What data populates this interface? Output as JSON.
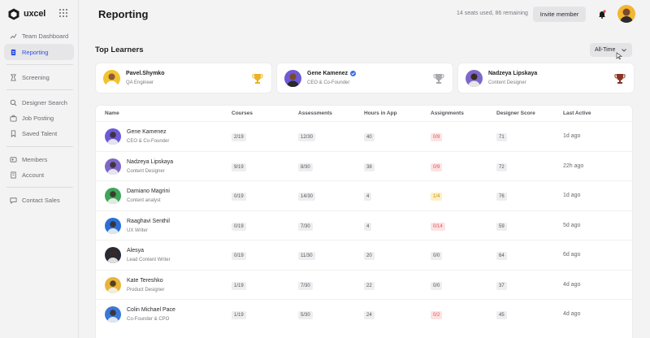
{
  "brand": {
    "name": "uxcel"
  },
  "sidebar": {
    "items": [
      {
        "label": "Team Dashboard",
        "icon": "trend-up-icon"
      },
      {
        "label": "Reporting",
        "icon": "report-icon",
        "active": true
      },
      {
        "label": "Screening",
        "icon": "screening-icon"
      },
      {
        "label": "Designer Search",
        "icon": "search-icon"
      },
      {
        "label": "Job Posting",
        "icon": "briefcase-icon"
      },
      {
        "label": "Saved Talent",
        "icon": "bookmark-icon"
      },
      {
        "label": "Members",
        "icon": "members-icon"
      },
      {
        "label": "Account",
        "icon": "building-icon"
      },
      {
        "label": "Contact Sales",
        "icon": "chat-icon"
      }
    ]
  },
  "header": {
    "title": "Reporting",
    "seats": "14 seats used, 86 remaining",
    "invite_label": "Invite member"
  },
  "top_learners": {
    "title": "Top Learners",
    "filter_label": "All-Time",
    "cards": [
      {
        "name": "Pavel.Shymko",
        "role": "QA Engineer",
        "trophy": "gold",
        "color": "#f2c230"
      },
      {
        "name": "Gene Kamenez",
        "role": "CEO & Co-Founder",
        "trophy": "silver",
        "color": "#6b5bd6",
        "verified": true
      },
      {
        "name": "Nadzeya Lipskaya",
        "role": "Content Designer",
        "trophy": "bronze",
        "color": "#7d68c9"
      }
    ]
  },
  "table": {
    "headers": [
      "Name",
      "Courses",
      "Assessments",
      "Hours in App",
      "Assignments",
      "Designer Score",
      "Last Active"
    ],
    "rows": [
      {
        "name": "Gene Kamenez",
        "role": "CEO & Co-Founder",
        "courses": "2/19",
        "assessments": "12/30",
        "hours": "40",
        "assignments": "0/9",
        "a_status": "red",
        "score": "71",
        "last": "1d ago",
        "color": "#6b5bd6"
      },
      {
        "name": "Nadzeya Lipskaya",
        "role": "Content Designer",
        "courses": "9/19",
        "assessments": "8/30",
        "hours": "38",
        "assignments": "0/9",
        "a_status": "red",
        "score": "72",
        "last": "22h ago",
        "color": "#7d68c9"
      },
      {
        "name": "Damiano Magrini",
        "role": "Content analyst",
        "courses": "0/19",
        "assessments": "14/30",
        "hours": "4",
        "assignments": "1/4",
        "a_status": "yellow",
        "score": "76",
        "last": "1d ago",
        "color": "#3fa55a"
      },
      {
        "name": "Raaghavi Senthil",
        "role": "UX Writer",
        "courses": "0/19",
        "assessments": "7/30",
        "hours": "4",
        "assignments": "0/14",
        "a_status": "red",
        "score": "59",
        "last": "5d ago",
        "color": "#2b6fd6"
      },
      {
        "name": "Alesya",
        "role": "Lead Content Writer",
        "courses": "0/19",
        "assessments": "11/30",
        "hours": "20",
        "assignments": "0/0",
        "a_status": "gray",
        "score": "64",
        "last": "6d ago",
        "color": "#2a2a35"
      },
      {
        "name": "Kate Tereshko",
        "role": "Product Designer",
        "courses": "1/19",
        "assessments": "7/30",
        "hours": "22",
        "assignments": "0/0",
        "a_status": "gray",
        "score": "37",
        "last": "4d ago",
        "color": "#e8b53a"
      },
      {
        "name": "Colin Michael Pace",
        "role": "Co-Founder & CPO",
        "courses": "1/19",
        "assessments": "5/30",
        "hours": "24",
        "assignments": "0/2",
        "a_status": "red",
        "score": "45",
        "last": "4d ago",
        "color": "#3a78d6"
      }
    ]
  }
}
